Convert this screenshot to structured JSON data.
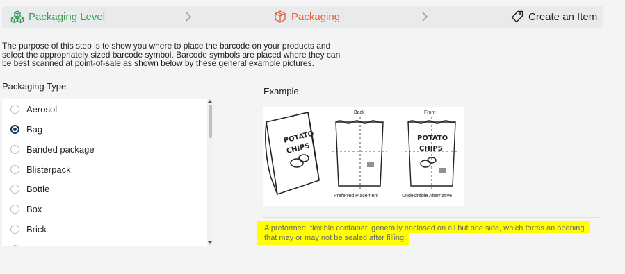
{
  "stepper": {
    "steps": [
      {
        "label": "Packaging Level",
        "icon": "cubes-icon",
        "color": "#3a9d54"
      },
      {
        "label": "Packaging",
        "icon": "box-icon",
        "color": "#e8603f"
      },
      {
        "label": "Create an Item",
        "icon": "tag-icon",
        "color": "#222222"
      }
    ]
  },
  "intro": {
    "text": "The purpose of this step is to show you where to place the barcode on your products and select the appropriately sized barcode symbol. Barcode symbols are placed where they can be best scanned at point-of-sale as shown below by these general example pictures."
  },
  "packaging_type": {
    "label": "Packaging Type",
    "selected": "Bag",
    "options": [
      "Aerosol",
      "Bag",
      "Banded package",
      "Blisterpack",
      "Bottle",
      "Box",
      "Brick"
    ]
  },
  "example": {
    "label": "Example",
    "image": {
      "back_label": "Back",
      "front_label": "Front",
      "preferred_label": "Preferred Placement",
      "undesirable_label": "Undesirable Alternative",
      "bag_text_1": "POTATO",
      "bag_text_2": "CHIPS"
    }
  },
  "description": {
    "line1": "A preformed, flexible container, generally enclosed on all but one side, which forms an opening",
    "line2": "that may or may not be sealed after filling.",
    "highlight_color": "#ffff00"
  }
}
